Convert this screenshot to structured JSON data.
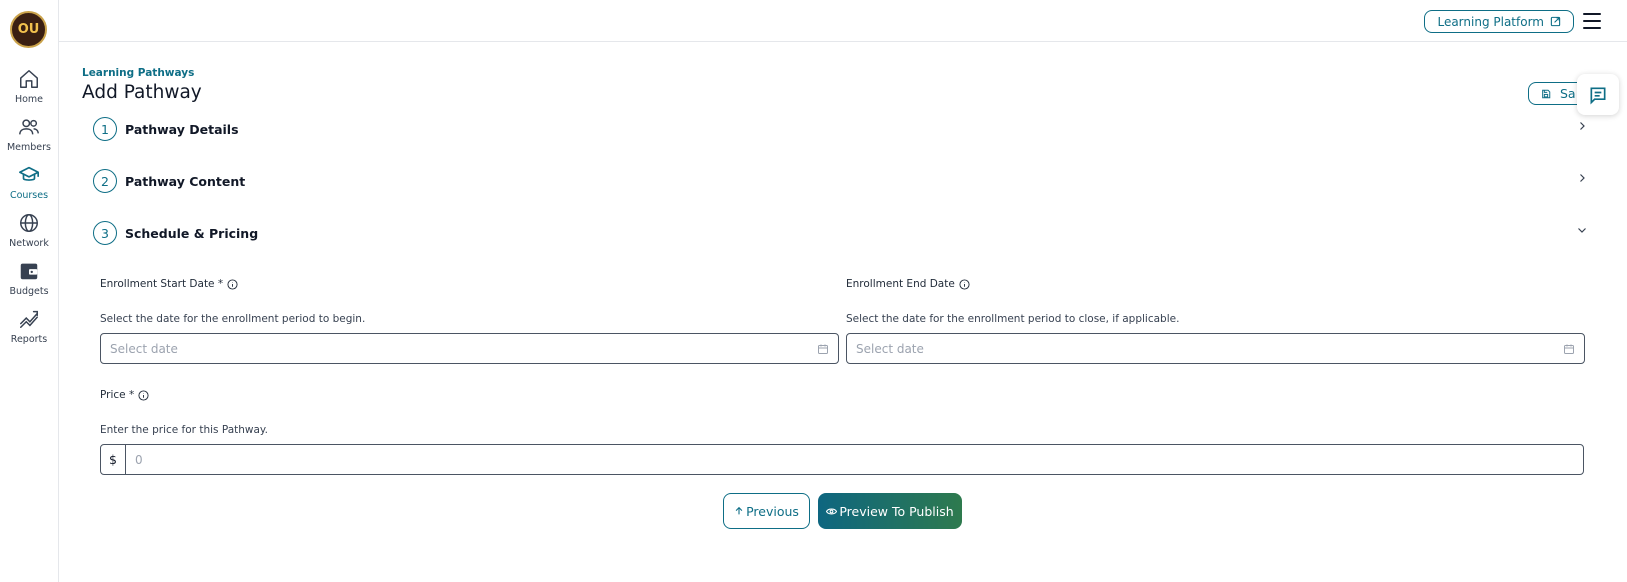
{
  "sidebar": {
    "logo_text": "OU",
    "items": [
      {
        "label": "Home",
        "icon": "home-icon"
      },
      {
        "label": "Members",
        "icon": "members-icon"
      },
      {
        "label": "Courses",
        "icon": "courses-icon",
        "active": true
      },
      {
        "label": "Network",
        "icon": "globe-icon"
      },
      {
        "label": "Budgets",
        "icon": "wallet-icon"
      },
      {
        "label": "Reports",
        "icon": "reports-icon"
      }
    ]
  },
  "topbar": {
    "learning_platform_label": "Learning Platform"
  },
  "header": {
    "breadcrumb": "Learning Pathways",
    "title": "Add Pathway",
    "save_label": "Sa"
  },
  "steps": [
    {
      "number": "1",
      "title": "Pathway Details",
      "expanded": false
    },
    {
      "number": "2",
      "title": "Pathway Content",
      "expanded": false
    },
    {
      "number": "3",
      "title": "Schedule & Pricing",
      "expanded": true
    }
  ],
  "form": {
    "start_date": {
      "label": "Enrollment Start Date *",
      "help": "Select the date for the enrollment period to begin.",
      "placeholder": "Select date"
    },
    "end_date": {
      "label": "Enrollment End Date",
      "help": "Select the date for the enrollment period to close, if applicable.",
      "placeholder": "Select date"
    },
    "price": {
      "label": "Price *",
      "help": "Enter the price for this Pathway.",
      "prefix": "$",
      "placeholder": "0"
    }
  },
  "actions": {
    "previous_label": "Previous",
    "publish_label": "Preview To Publish"
  },
  "colors": {
    "accent": "#0e6e86",
    "publish_gradient_start": "#0e6680",
    "publish_gradient_end": "#2e7a4e"
  }
}
